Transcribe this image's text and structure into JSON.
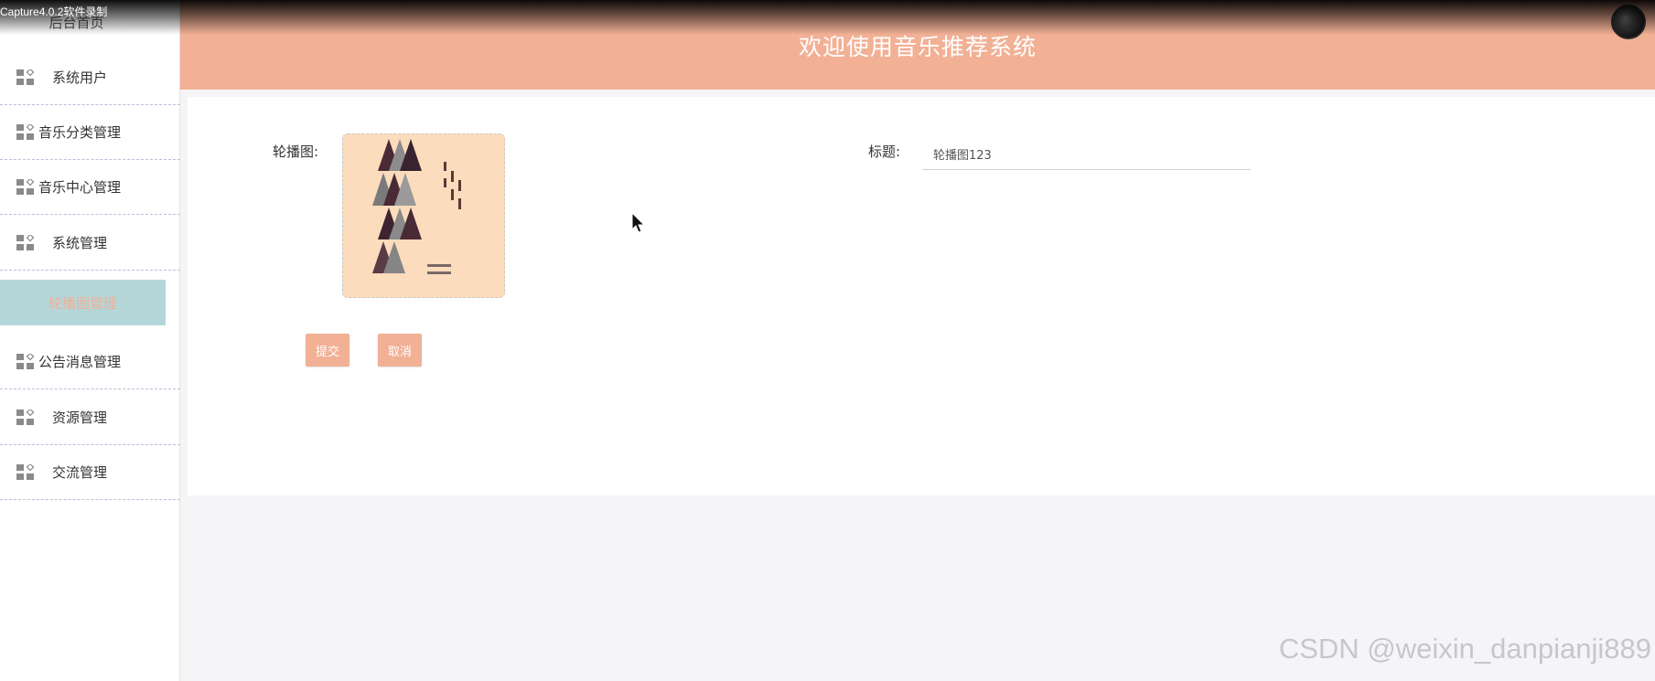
{
  "recorder": {
    "label": "Capture4.0.2软件录制"
  },
  "header": {
    "title": "欢迎使用音乐推荐系统"
  },
  "sidebar": {
    "home": "后台首页",
    "items": [
      {
        "label": "系统用户",
        "icon": "grid-icon"
      },
      {
        "label": "音乐分类管理",
        "icon": "grid-icon"
      },
      {
        "label": "音乐中心管理",
        "icon": "grid-icon"
      },
      {
        "label": "系统管理",
        "icon": "grid-icon"
      },
      {
        "label": "公告消息管理",
        "icon": "grid-icon"
      },
      {
        "label": "资源管理",
        "icon": "grid-icon"
      },
      {
        "label": "交流管理",
        "icon": "grid-icon"
      }
    ],
    "active": {
      "label": "轮播图管理"
    }
  },
  "form": {
    "image_label": "轮播图:",
    "title_label": "标题:",
    "title_value": "轮播图123",
    "submit": "提交",
    "cancel": "取消"
  },
  "watermark": {
    "text": "CSDN @weixin_danpianji889"
  },
  "colors": {
    "header": "#f2b095",
    "accent": "#f2b095",
    "active_bg": "#b5d6d9",
    "page_bg": "#f5f5f7"
  }
}
